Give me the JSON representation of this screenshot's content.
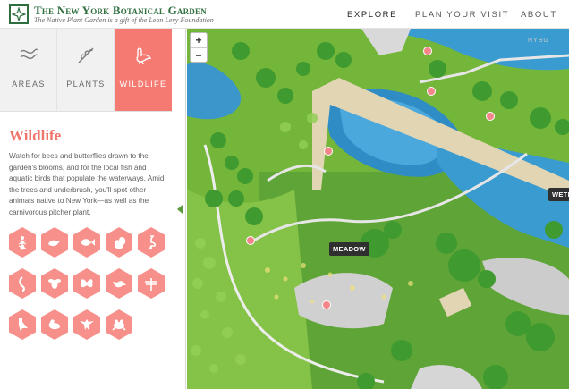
{
  "header": {
    "title": "The New York Botanical Garden",
    "subtitle": "The Native Plant Garden is a gift of the Leon Levy Foundation",
    "logo_icon": "nybg-logo-icon",
    "nav": {
      "explore": "EXPLORE",
      "plan": "PLAN YOUR VISIT",
      "about": "ABOUT"
    }
  },
  "sidebar": {
    "tabs": [
      {
        "label": "AREAS",
        "icon": "areas-icon"
      },
      {
        "label": "PLANTS",
        "icon": "plants-icon"
      },
      {
        "label": "WILDLIFE",
        "icon": "wildlife-icon",
        "active": true
      }
    ],
    "section_title": "Wildlife",
    "description": "Watch for bees and butterflies drawn to the garden's blooms, and for the local fish and aquatic birds that populate the waterways. Amid the trees and underbrush, you'll spot other animals native to New York—as well as the carnivorous pitcher plant.",
    "wildlife_icons": [
      "ant-icon",
      "bird-icon",
      "fish-icon",
      "squirrel-icon",
      "heron-icon",
      "caterpillar-icon",
      "bee-icon",
      "butterfly-icon",
      "songbird-icon",
      "dragonfly-icon",
      "woodpecker-icon",
      "duck-icon",
      "hawk-icon",
      "frog-icon"
    ],
    "accent_color": "#f57a72"
  },
  "map": {
    "zoom_in": "+",
    "zoom_out": "−",
    "labels": {
      "meadow": "MEADOW",
      "wetland": "WETL"
    },
    "corner_mark": "NYBG"
  }
}
